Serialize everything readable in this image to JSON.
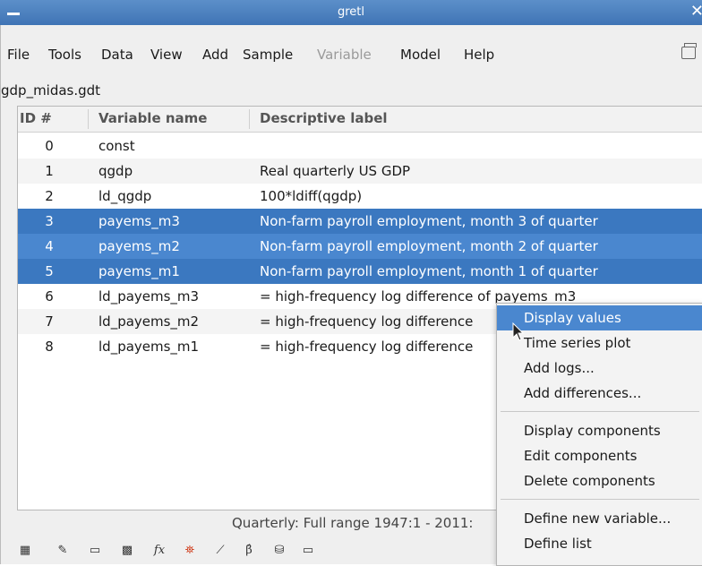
{
  "window": {
    "title": "gretl"
  },
  "menubar": {
    "items": [
      {
        "label": "File",
        "disabled": false
      },
      {
        "label": "Tools",
        "disabled": false
      },
      {
        "label": "Data",
        "disabled": false
      },
      {
        "label": "View",
        "disabled": false
      },
      {
        "label": "Add",
        "disabled": false
      },
      {
        "label": "Sample",
        "disabled": false
      },
      {
        "label": "Variable",
        "disabled": true
      },
      {
        "label": "Model",
        "disabled": false
      },
      {
        "label": "Help",
        "disabled": false
      }
    ]
  },
  "dataset": {
    "filename": "gdp_midas.gdt"
  },
  "table": {
    "headers": [
      "ID #",
      "Variable name",
      "Descriptive label"
    ],
    "rows": [
      {
        "id": "0",
        "name": "const",
        "label": ""
      },
      {
        "id": "1",
        "name": "qgdp",
        "label": "Real quarterly US GDP"
      },
      {
        "id": "2",
        "name": "ld_qgdp",
        "label": "100*ldiff(qgdp)"
      },
      {
        "id": "3",
        "name": "payems_m3",
        "label": "Non-farm payroll employment, month 3 of quarter"
      },
      {
        "id": "4",
        "name": "payems_m2",
        "label": "Non-farm payroll employment, month 2 of quarter"
      },
      {
        "id": "5",
        "name": "payems_m1",
        "label": "Non-farm payroll employment, month 1 of quarter"
      },
      {
        "id": "6",
        "name": "ld_payems_m3",
        "label": "= high-frequency log difference of payems_m3"
      },
      {
        "id": "7",
        "name": "ld_payems_m2",
        "label": "= high-frequency log difference"
      },
      {
        "id": "8",
        "name": "ld_payems_m1",
        "label": "= high-frequency log difference"
      }
    ]
  },
  "statusbar": {
    "text": "Quarterly: Full range 1947:1 - 2011:"
  },
  "toolbar": {
    "icons": [
      "calculator-icon",
      "script-editor-icon",
      "console-icon",
      "session-icon",
      "function-icon",
      "help-icon",
      "plot-icon",
      "beta-icon",
      "database-icon",
      "folder-icon"
    ]
  },
  "context_menu": {
    "items": [
      {
        "label": "Display values",
        "highlighted": true
      },
      {
        "label": "Time series plot"
      },
      {
        "label": "Add logs..."
      },
      {
        "label": "Add differences..."
      },
      {
        "label": "Display components"
      },
      {
        "label": "Edit components"
      },
      {
        "label": "Delete components"
      },
      {
        "label": "Define new variable..."
      },
      {
        "label": "Define list"
      }
    ]
  },
  "colors": {
    "titlebar": "#4a80c0",
    "selection": "#3b78c0",
    "highlight": "#4a87cf"
  }
}
